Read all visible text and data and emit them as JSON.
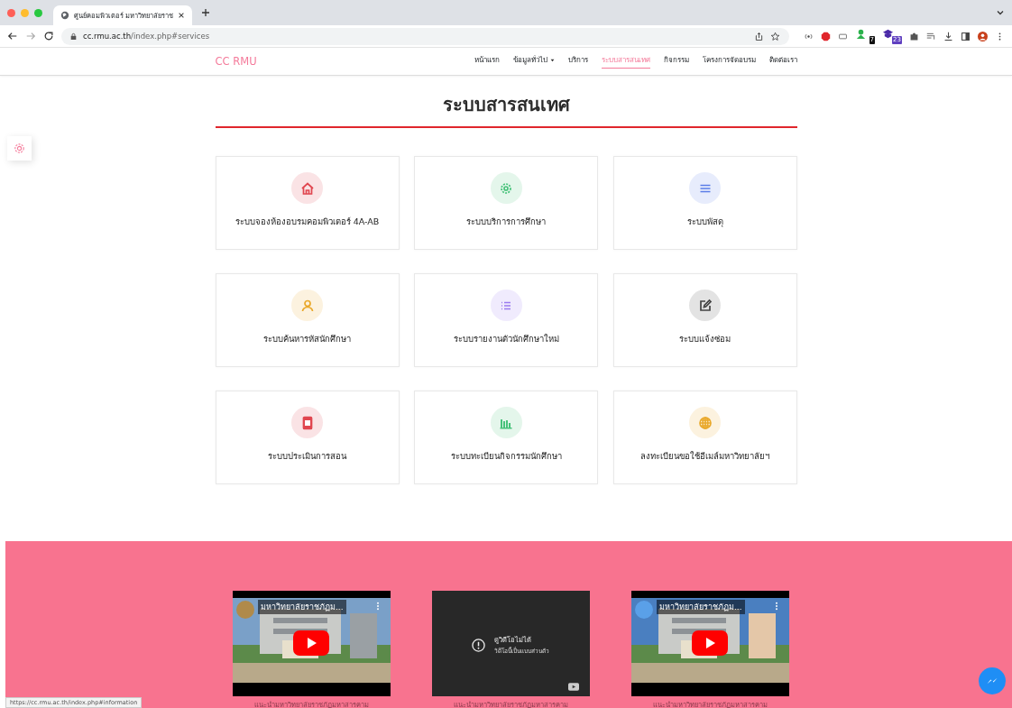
{
  "browser": {
    "tab_title": "ศูนย์คอมพิวเตอร์ มหาวิทยาลัยราช",
    "url_host": "cc.rmu.ac.th",
    "url_path": "/index.php#services",
    "extension_badges": [
      "7",
      "23"
    ],
    "status_url": "https://cc.rmu.ac.th/index.php#information"
  },
  "nav": {
    "brand": "CC RMU",
    "items": [
      {
        "label": "หน้าแรก",
        "selected": false,
        "dropdown": false
      },
      {
        "label": "ข้อมูลทั่วไป",
        "selected": false,
        "dropdown": true
      },
      {
        "label": "บริการ",
        "selected": false,
        "dropdown": false
      },
      {
        "label": "ระบบสารสนเทศ",
        "selected": true,
        "dropdown": false
      },
      {
        "label": "กิจกรรม",
        "selected": false,
        "dropdown": false
      },
      {
        "label": "โครงการจัดอบรม",
        "selected": false,
        "dropdown": false
      },
      {
        "label": "ติดต่อเรา",
        "selected": false,
        "dropdown": false
      }
    ]
  },
  "section_title": "ระบบสารสนเทศ",
  "services": [
    {
      "label": "ระบบจองห้องอบรมคอมพิวเตอร์ 4A-AB",
      "kind": "home",
      "color": "#e0464f"
    },
    {
      "label": "ระบบบริการการศึกษา",
      "kind": "gear",
      "color": "#47c27a"
    },
    {
      "label": "ระบบพัสดุ",
      "kind": "menu",
      "color": "#5b7de8"
    },
    {
      "label": "ระบบค้นหารหัสนักศึกษา",
      "kind": "user",
      "color": "#e9a82a"
    },
    {
      "label": "ระบบรายงานตัวนักศึกษาใหม่",
      "kind": "list",
      "color": "#9a7bf0"
    },
    {
      "label": "ระบบแจ้งซ่อม",
      "kind": "edit",
      "color": "#444444"
    },
    {
      "label": "ระบบประเมินการสอน",
      "kind": "phone",
      "color": "#e0464f"
    },
    {
      "label": "ระบบทะเบียนกิจกรรมนักศึกษา",
      "kind": "chart",
      "color": "#47c27a"
    },
    {
      "label": "ลงทะเบียนขอใช้อีเมล์มหาวิทยาลัยฯ",
      "kind": "globe",
      "color": "#e9a82a"
    }
  ],
  "videos": [
    {
      "kind": "picture",
      "title": "มหาวิทยาลัยราชภัฏม...",
      "caption": "แนะนำมหาวิทยาลัยราชภัฏมหาสารคาม"
    },
    {
      "kind": "private",
      "message": "ดูวิดีโอไม่ได้",
      "detail": "วิดีโอนี้เป็นแบบส่วนตัว",
      "caption": "แนะนำมหาวิทยาลัยราชภัฏมหาสารคาม"
    },
    {
      "kind": "picture",
      "title": "มหาวิทยาลัยราชภัฏม...",
      "caption": "แนะนำมหาวิทยาลัยราชภัฏมหาสารคาม"
    }
  ]
}
